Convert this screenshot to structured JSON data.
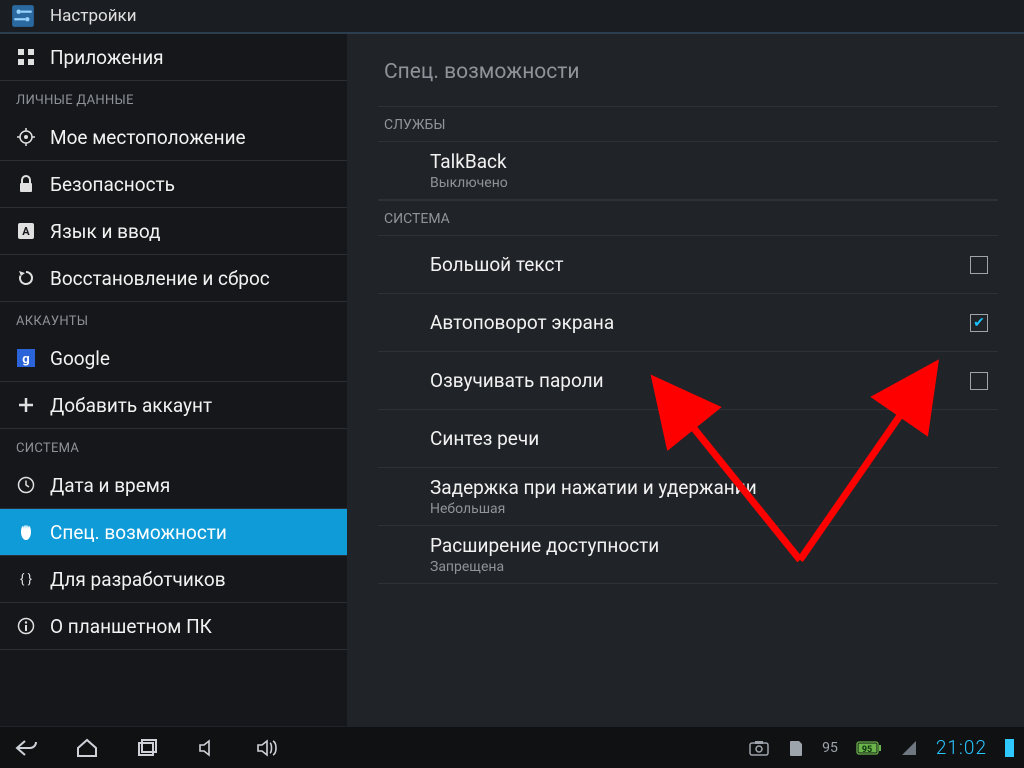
{
  "app": {
    "title": "Настройки"
  },
  "sidebar": {
    "items": [
      {
        "label": "Приложения",
        "icon": "apps-icon"
      }
    ],
    "section_personal": "ЛИЧНЫЕ ДАННЫЕ",
    "personal": [
      {
        "label": "Мое местоположение",
        "icon": "location-icon"
      },
      {
        "label": "Безопасность",
        "icon": "lock-icon"
      },
      {
        "label": "Язык и ввод",
        "icon": "language-icon"
      },
      {
        "label": "Восстановление и сброс",
        "icon": "reset-icon"
      }
    ],
    "section_accounts": "АККАУНТЫ",
    "accounts": [
      {
        "label": "Google",
        "icon": "google-icon"
      },
      {
        "label": "Добавить аккаунт",
        "icon": "plus-icon"
      }
    ],
    "section_system": "СИСТЕМА",
    "system": [
      {
        "label": "Дата и время",
        "icon": "clock-icon"
      },
      {
        "label": "Спец. возможности",
        "icon": "accessibility-hand-icon"
      },
      {
        "label": "Для разработчиков",
        "icon": "dev-icon"
      },
      {
        "label": "О планшетном ПК",
        "icon": "info-icon"
      }
    ],
    "selected_label": "Спец. возможности"
  },
  "detail": {
    "title": "Спец. возможности",
    "section_services": "СЛУЖБЫ",
    "services": [
      {
        "label": "TalkBack",
        "sub": "Выключено"
      }
    ],
    "section_system": "СИСТЕМА",
    "system": [
      {
        "label": "Большой текст",
        "checkbox": false
      },
      {
        "label": "Автоповорот экрана",
        "checkbox": true
      },
      {
        "label": "Озвучивать пароли",
        "checkbox": false
      },
      {
        "label": "Синтез речи"
      },
      {
        "label": "Задержка при нажатии и удержании",
        "sub": "Небольшая"
      },
      {
        "label": "Расширение доступности",
        "sub": "Запрещена"
      }
    ]
  },
  "statusbar": {
    "battery_pct": "95",
    "clock": "21:02"
  },
  "colors": {
    "accent": "#0f9bd8",
    "hl": "#18c2ff",
    "arrow": "#ff0000"
  }
}
